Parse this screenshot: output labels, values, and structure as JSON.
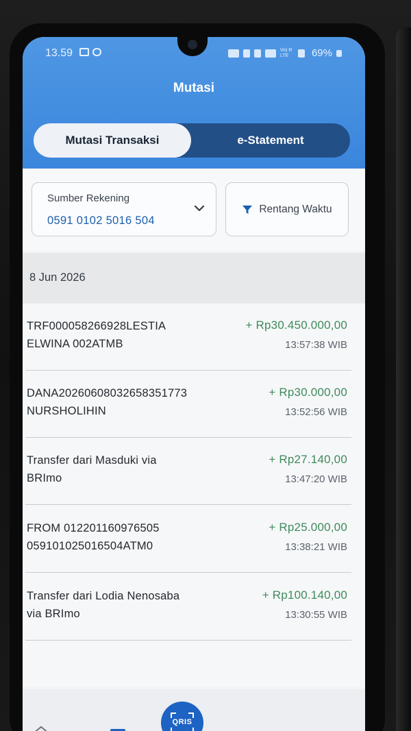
{
  "status": {
    "time": "13.59",
    "battery": "69%",
    "network_label": "Vo) R LTE"
  },
  "header": {
    "title": "Mutasi",
    "tabs": [
      {
        "label": "Mutasi Transaksi",
        "active": true
      },
      {
        "label": "e-Statement",
        "active": false
      }
    ]
  },
  "filters": {
    "source_label": "Sumber Rekening",
    "source_value": "0591 0102 5016 504",
    "range_label": "Rentang Waktu"
  },
  "date_group": "8 Jun 2026",
  "transactions": [
    {
      "desc": "TRF000058266928LESTIA\nELWINA 002ATMB",
      "amount": "+ Rp30.450.000,00",
      "time": "13:57:38 WIB"
    },
    {
      "desc": "DANA20260608032658351773\nNURSHOLIHIN",
      "amount": "+ Rp30.000,00",
      "time": "13:52:56 WIB"
    },
    {
      "desc": "Transfer dari Masduki via\nBRImo",
      "amount": "+ Rp27.140,00",
      "time": "13:47:20 WIB"
    },
    {
      "desc": "FROM 012201160976505\n059101025016504ATM0",
      "amount": "+ Rp25.000,00",
      "time": "13:38:21 WIB"
    },
    {
      "desc": "Transfer dari Lodia Nenosaba\nvia BRImo",
      "amount": "+ Rp100.140,00",
      "time": "13:30:55 WIB"
    }
  ],
  "bottom_nav": {
    "qris_label": "QRIS"
  },
  "colors": {
    "header_blue": "#3a86dc",
    "tab_dark": "#234f87",
    "amount_green": "#3d8b5c",
    "account_blue": "#1d5fae",
    "qris_blue": "#1d63c3"
  }
}
